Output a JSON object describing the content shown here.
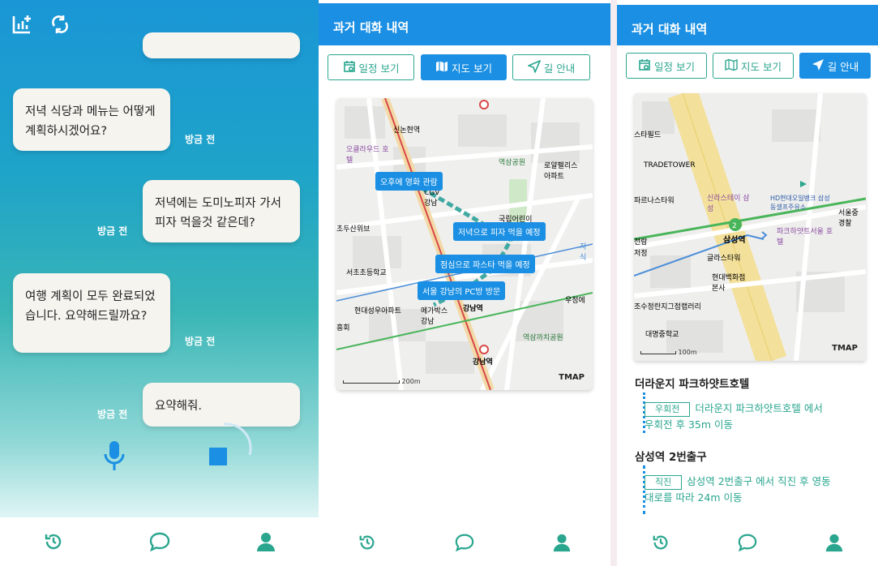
{
  "chat": {
    "messages": [
      {
        "from": "bot",
        "text": "저녁 식당과 메뉴는 어떻게 계획하시겠어요?",
        "time": "방금 전"
      },
      {
        "from": "user",
        "text": "저녁에는 도미노피자 가서 피자 먹을것 같은데?",
        "time": "방금 전"
      },
      {
        "from": "bot",
        "text": "여행 계획이 모두 완료되었습니다. 요약해드릴까요?",
        "time": "방금 전"
      },
      {
        "from": "user",
        "text": "요약해줘.",
        "time": "방금 전"
      }
    ]
  },
  "history": {
    "title": "과거 대화 내역",
    "buttons": {
      "schedule": "일정 보기",
      "map": "지도 보기",
      "directions": "길 안내"
    }
  },
  "map1": {
    "tags": [
      "오후에 영화 관람",
      "저녁으로 피자 먹을 예정",
      "점심으로 파스타 먹을 예정",
      "서울 강남의 PC방 방문"
    ],
    "labels": {
      "station_top": "신논현역",
      "hotel": "오클라우드 호텔",
      "park": "역삼공원",
      "apartment": "로얄펠리스 아파트",
      "cgv": "CGV 강남",
      "library": "국립어린이",
      "club": "초두산위브",
      "school": "서초초등학교",
      "apartment2": "현대성우아파트",
      "megabox": "메가박스 강남",
      "station_gangnam": "강남역",
      "station_gangnam2": "강남역",
      "park2": "역삼까치공원",
      "office": "우정에",
      "edge_right": "지식",
      "edge_left": "흥회"
    },
    "scale": "200m",
    "brand": "TMAP"
  },
  "map2": {
    "labels": {
      "tower1": "스타필드",
      "tower2": "TRADETOWER",
      "tower3": "파르나스타워",
      "hotel": "신라스테이 삼성",
      "bank": "HD현대오일뱅크 삼성동셀프주유소",
      "station": "삼성역",
      "exit": "2",
      "parkhyatt": "파크하얏트서울 호텔",
      "klass": "글라스타워",
      "dept": "현대백화점 본사",
      "church": "조수정란지그점랩러리",
      "school": "대명중학교",
      "seoul": "서울중 경찰",
      "left1": "전람",
      "left2": "저정"
    },
    "scale": "100m",
    "brand": "TMAP"
  },
  "steps": [
    {
      "title": "더라운지 파크하얏트호텔",
      "badge": "우회전",
      "text1": "더라운지 파크하얏트호텔 에서",
      "text2": "우회전 후 35m 이동"
    },
    {
      "title": "삼성역 2번출구",
      "badge": "직진",
      "text1": "삼성역 2번출구 에서 직진 후 영동",
      "text2": "대로를 따라 24m 이동"
    }
  ],
  "colors": {
    "primary": "#1a8fe3",
    "accent": "#2aa68f",
    "bubble": "#f6f4ef"
  }
}
